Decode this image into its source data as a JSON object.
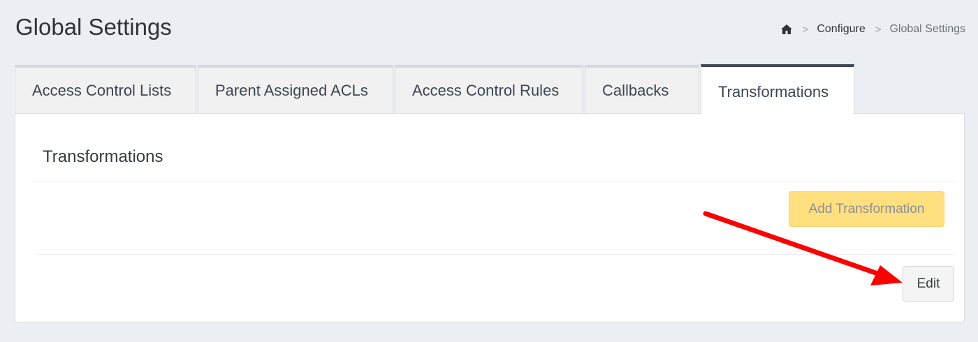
{
  "header": {
    "title": "Global Settings",
    "breadcrumb": {
      "home_icon": "home-icon",
      "separator": ">",
      "items": [
        "Configure",
        "Global Settings"
      ]
    }
  },
  "tabs": [
    {
      "label": "Access Control Lists",
      "active": false
    },
    {
      "label": "Parent Assigned ACLs",
      "active": false
    },
    {
      "label": "Access Control Rules",
      "active": false
    },
    {
      "label": "Callbacks",
      "active": false
    },
    {
      "label": "Transformations",
      "active": true
    }
  ],
  "panel": {
    "heading": "Transformations",
    "add_button_label": "Add Transformation",
    "edit_button_label": "Edit"
  },
  "annotation": {
    "type": "arrow",
    "color": "#ff0000",
    "points_to": "edit-button"
  },
  "colors": {
    "background": "#ebeef2",
    "add_button": "#ffdf7e",
    "active_tab_border": "#3f4a55"
  }
}
